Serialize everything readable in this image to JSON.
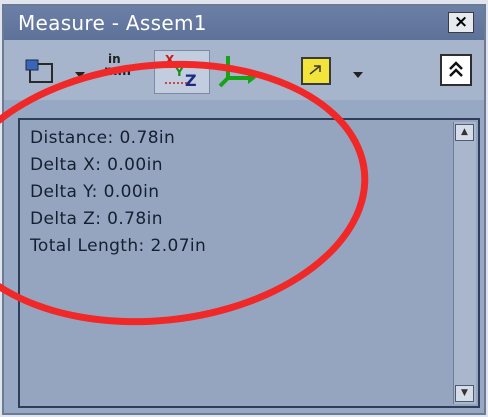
{
  "window": {
    "title": "Measure - Assem1",
    "close_glyph": "×"
  },
  "toolbar": {
    "units_top": "in",
    "units_bottom": "mm",
    "xyz": {
      "x": "X",
      "y": "Y",
      "z": "Z"
    },
    "collapse_glyph": "^",
    "icons": [
      "select-tool-icon",
      "units-icon",
      "xyz-dimensions-icon",
      "point-to-point-icon",
      "yellow-folder-icon",
      "collapse-icon"
    ]
  },
  "results": {
    "lines": [
      "Distance: 0.78in",
      "Delta X: 0.00in",
      "Delta Y: 0.00in",
      "Delta Z: 0.78in",
      "Total Length: 2.07in"
    ]
  },
  "colors": {
    "titlebar": "#6c7fa6",
    "panel": "#95a5c0",
    "highlight_circle": "#f02828"
  }
}
